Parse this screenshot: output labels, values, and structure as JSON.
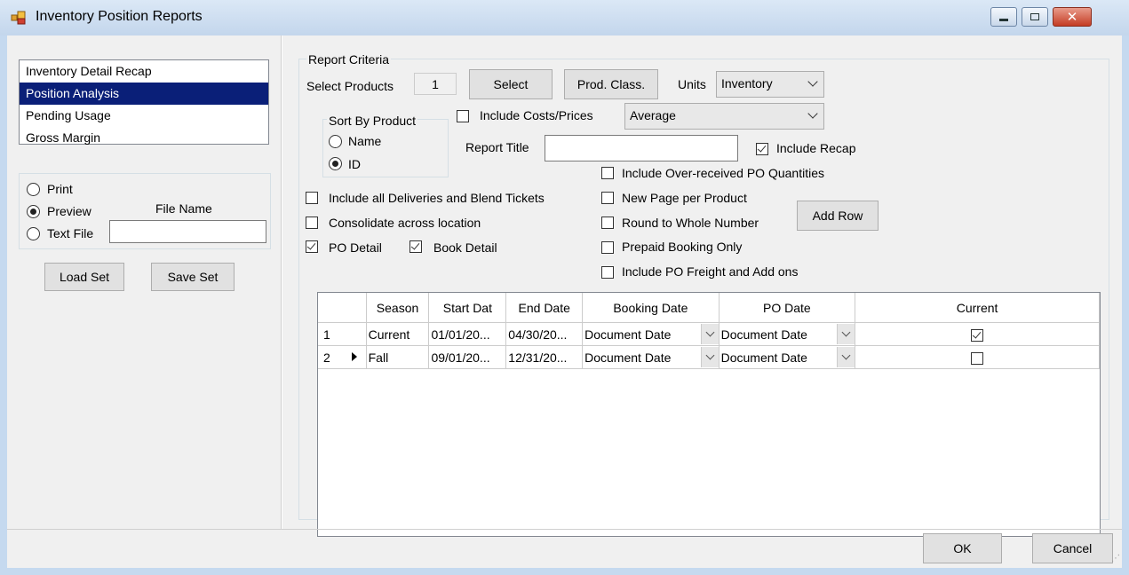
{
  "window": {
    "title": "Inventory Position Reports"
  },
  "report_list": {
    "items": [
      "Inventory Detail Recap",
      "Position Analysis",
      "Pending Usage",
      "Gross Margin"
    ],
    "selected_index": 1
  },
  "output": {
    "print_label": "Print",
    "preview_label": "Preview",
    "textfile_label": "Text File",
    "file_name_label": "File Name",
    "file_name_value": "",
    "selected": "Preview"
  },
  "buttons": {
    "load_set": "Load Set",
    "save_set": "Save Set",
    "select": "Select",
    "prod_class": "Prod. Class.",
    "add_row": "Add Row",
    "ok": "OK",
    "cancel": "Cancel"
  },
  "criteria": {
    "group_label": "Report Criteria",
    "select_products_label": "Select Products",
    "select_products_count": "1",
    "units_label": "Units",
    "units_value": "Inventory",
    "sort_group_label": "Sort By Product",
    "sort_name_label": "Name",
    "sort_id_label": "ID",
    "sort_selected": "ID",
    "include_costs_label": "Include Costs/Prices",
    "include_costs_checked": false,
    "costs_method_value": "Average",
    "report_title_label": "Report Title",
    "report_title_value": "",
    "include_recap_label": "Include Recap",
    "include_recap_checked": true,
    "include_over_received_label": "Include Over-received PO Quantities",
    "include_all_deliveries_label": "Include all Deliveries and Blend Tickets",
    "new_page_label": "New Page per Product",
    "consolidate_label": "Consolidate across location",
    "round_label": "Round to Whole Number",
    "po_detail_label": "PO Detail",
    "po_detail_checked": true,
    "book_detail_label": "Book Detail",
    "book_detail_checked": true,
    "prepaid_label": "Prepaid Booking Only",
    "po_freight_label": "Include PO Freight and Add ons"
  },
  "grid": {
    "columns": [
      "Season",
      "Start Dat",
      "End Date",
      "Booking Date",
      "PO Date",
      "Current"
    ],
    "rows": [
      {
        "num": "1",
        "season": "Current",
        "start": "01/01/20...",
        "end": "04/30/20...",
        "booking": "Document Date",
        "po": "Document Date",
        "current": true,
        "active": false
      },
      {
        "num": "2",
        "season": "Fall",
        "start": "09/01/20...",
        "end": "12/31/20...",
        "booking": "Document Date",
        "po": "Document Date",
        "current": false,
        "active": true
      }
    ]
  }
}
